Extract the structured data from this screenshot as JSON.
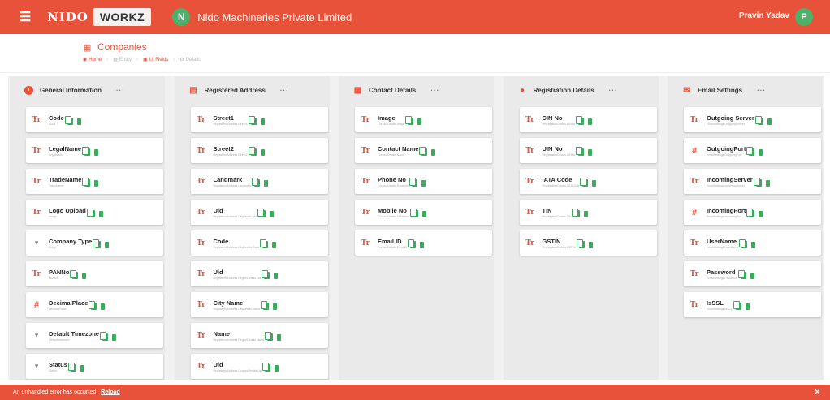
{
  "header": {
    "brand_primary": "NIDO",
    "brand_secondary": "WORKZ",
    "company_initial": "N",
    "company_name": "Nido Machineries Private Limited",
    "user_name": "Pravin Yadav",
    "user_initial": "P",
    "accent_color": "#e8523a"
  },
  "page": {
    "title": "Companies",
    "breadcrumb": [
      "Home",
      "Entity",
      "UI Fields",
      "Details"
    ]
  },
  "columns": [
    {
      "key": "general",
      "title": "General Information",
      "icon": "info-icon",
      "more": "···",
      "items": [
        {
          "name": "Code",
          "sub": "Code",
          "type": "text"
        },
        {
          "name": "LegalName",
          "sub": "LegalName",
          "type": "text"
        },
        {
          "name": "TradeName",
          "sub": "TradeName",
          "type": "text"
        },
        {
          "name": "Logo Upload",
          "sub": "Image",
          "type": "text"
        },
        {
          "name": "Company Type",
          "sub": "Entity",
          "type": "dropdown"
        },
        {
          "name": "PANNo",
          "sub": "PANNo",
          "type": "text"
        },
        {
          "name": "DecimalPlace",
          "sub": "DecimalPlace",
          "type": "number"
        },
        {
          "name": "Default Timezone",
          "sub": "Defaulttimezone",
          "type": "dropdown"
        },
        {
          "name": "Status",
          "sub": "Status",
          "type": "dropdown"
        }
      ]
    },
    {
      "key": "address",
      "title": "Registered Address",
      "icon": "address-card-icon",
      "more": "···",
      "items": [
        {
          "name": "Street1",
          "sub": "RegisteredAddress.Street1",
          "type": "text"
        },
        {
          "name": "Street2",
          "sub": "RegisteredAddress.Street2",
          "type": "text"
        },
        {
          "name": "Landmark",
          "sub": "RegisteredAddress.Landmark",
          "type": "text"
        },
        {
          "name": "Uid",
          "sub": "RegisteredAddress.CityDetails.Uid",
          "type": "text"
        },
        {
          "name": "Code",
          "sub": "RegisteredAddress.CityDetails.Code",
          "type": "text"
        },
        {
          "name": "Uid",
          "sub": "RegisteredAddress.RegionDetails.Uid",
          "type": "text"
        },
        {
          "name": "City Name",
          "sub": "RegisteredAddress.CityDetails.Name",
          "type": "text"
        },
        {
          "name": "Name",
          "sub": "RegisteredAddress.RegionDetails.Name",
          "type": "text"
        },
        {
          "name": "Uid",
          "sub": "RegisteredAddress.CountryDetails.Uid",
          "type": "text"
        }
      ]
    },
    {
      "key": "contact",
      "title": "Contact Details",
      "icon": "contact-book-icon",
      "more": "···",
      "items": [
        {
          "name": "Image",
          "sub": "ContactDetails.Image",
          "type": "text"
        },
        {
          "name": "Contact Name",
          "sub": "ContactDetails.Name",
          "type": "text"
        },
        {
          "name": "Phone No",
          "sub": "ContactDetails.PhoneNo",
          "type": "text"
        },
        {
          "name": "Mobile No",
          "sub": "ContactDetails.MobileNo",
          "type": "text"
        },
        {
          "name": "Email ID",
          "sub": "ContactDetails.EmailID",
          "type": "text"
        }
      ]
    },
    {
      "key": "registration",
      "title": "Registration Details",
      "icon": "circle-icon",
      "more": "···",
      "items": [
        {
          "name": "CIN No",
          "sub": "RegistrationDetails.CINNo",
          "type": "text"
        },
        {
          "name": "UIN No",
          "sub": "RegistrationDetails.UINNo",
          "type": "text"
        },
        {
          "name": "IATA Code",
          "sub": "RegistrationDetails.IATACode",
          "type": "text"
        },
        {
          "name": "TIN",
          "sub": "RegistrationDetails.TIN",
          "type": "text"
        },
        {
          "name": "GSTIN",
          "sub": "RegistrationDetails.GSTIN",
          "type": "text"
        }
      ]
    },
    {
      "key": "email",
      "title": "Email Settings",
      "icon": "mail-settings-icon",
      "more": "···",
      "items": [
        {
          "name": "Outgoing Server",
          "sub": "EmailSettings.OutgoingServer",
          "type": "text"
        },
        {
          "name": "OutgoingPort",
          "sub": "EmailSettings.OutgoingPort",
          "type": "number"
        },
        {
          "name": "IncomingServer",
          "sub": "EmailSettings.IncomingServer",
          "type": "text"
        },
        {
          "name": "IncomingPort",
          "sub": "EmailSettings.IncomingPort",
          "type": "number"
        },
        {
          "name": "UserName",
          "sub": "EmailSettings.UserName",
          "type": "text"
        },
        {
          "name": "Password",
          "sub": "EmailSettings.Password",
          "type": "text"
        },
        {
          "name": "IsSSL",
          "sub": "EmailSettings.IsSSL",
          "type": "text"
        }
      ]
    }
  ],
  "error": {
    "message": "An unhandled error has occurred.",
    "link_label": "Reload",
    "close": "✕"
  }
}
